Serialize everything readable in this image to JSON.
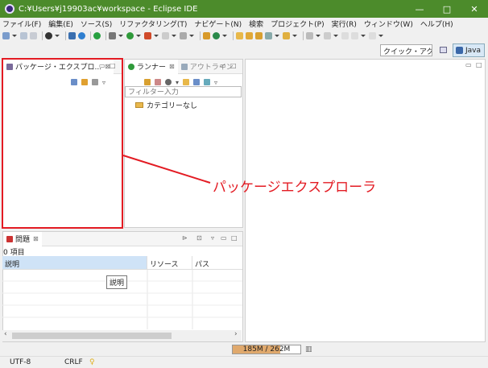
{
  "window": {
    "title": "C:¥Users¥j19903ac¥workspace - Eclipse IDE",
    "minimize": "—",
    "maximize": "□",
    "close": "✕"
  },
  "menu": [
    "ファイル(F)",
    "編集(E)",
    "ソース(S)",
    "リファクタリング(T)",
    "ナビゲート(N)",
    "検索",
    "プロジェクト(P)",
    "実行(R)",
    "ウィンドウ(W)",
    "ヘルプ(H)"
  ],
  "toolbar": {
    "quick_access": "クイック・アクセス",
    "perspective_java": "Java"
  },
  "package_explorer": {
    "tab_label": "パッケージ・エクスプロ...",
    "close_glyph": "⊠"
  },
  "runner": {
    "tab_label": "ランナー",
    "outline_tab_label": "アウトライン",
    "filter_placeholder": "フィルター入力",
    "category": "カテゴリーなし"
  },
  "annotation": {
    "label": "パッケージエクスプローラ",
    "color": "#e31b23"
  },
  "problems": {
    "tab_label": "問題",
    "count": "0 項目",
    "columns": [
      "説明",
      "リソース",
      "パス"
    ],
    "tooltip": "説明"
  },
  "status": {
    "heap": "185M / 262M",
    "heap_fraction": 0.706,
    "encoding": "UTF-8",
    "line_ending": "CRLF"
  },
  "colors": {
    "titlebar": "#4c8b2b",
    "annotation": "#e31b23",
    "selected_header": "#cfe3f7"
  }
}
